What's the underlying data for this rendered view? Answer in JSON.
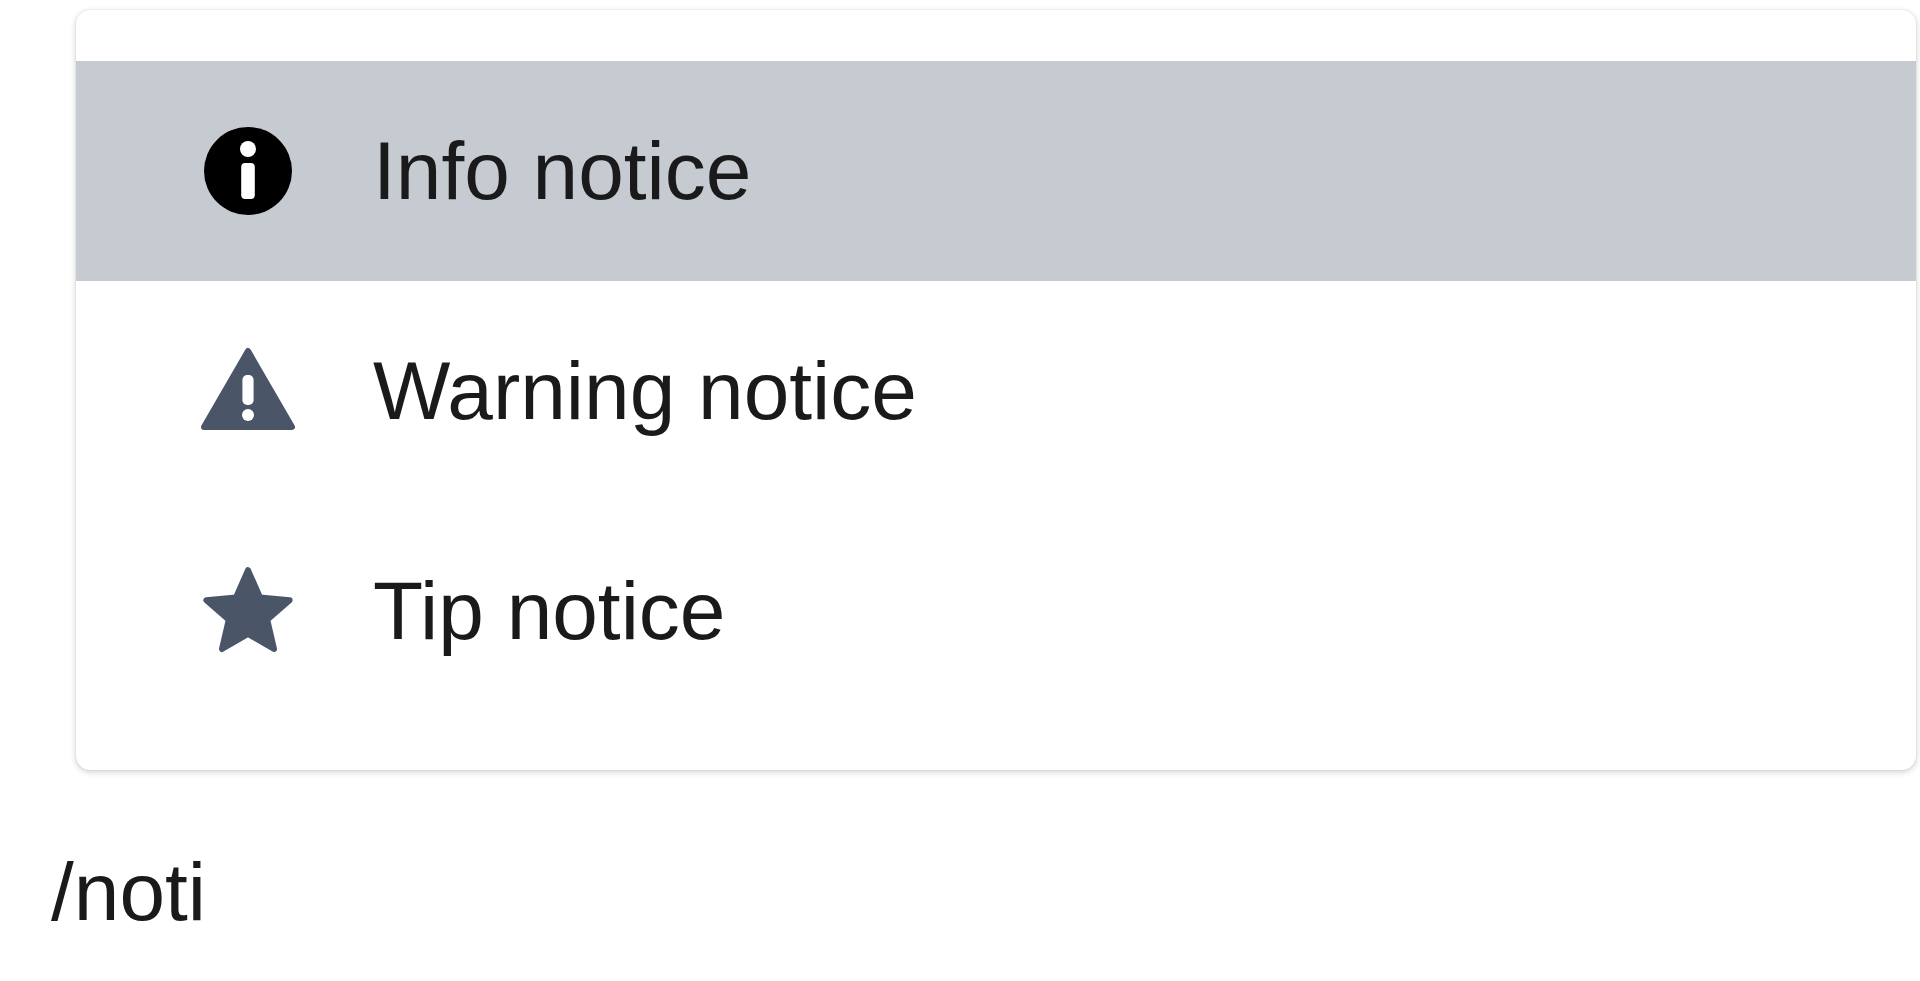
{
  "document": {
    "command_line": {
      "text": "/noti"
    }
  },
  "menu": {
    "items": [
      {
        "label": "Info notice",
        "kind": "info",
        "selected": true
      },
      {
        "label": "Warning notice",
        "kind": "warning",
        "selected": false
      },
      {
        "label": "Tip notice",
        "kind": "tip",
        "selected": false
      }
    ]
  }
}
